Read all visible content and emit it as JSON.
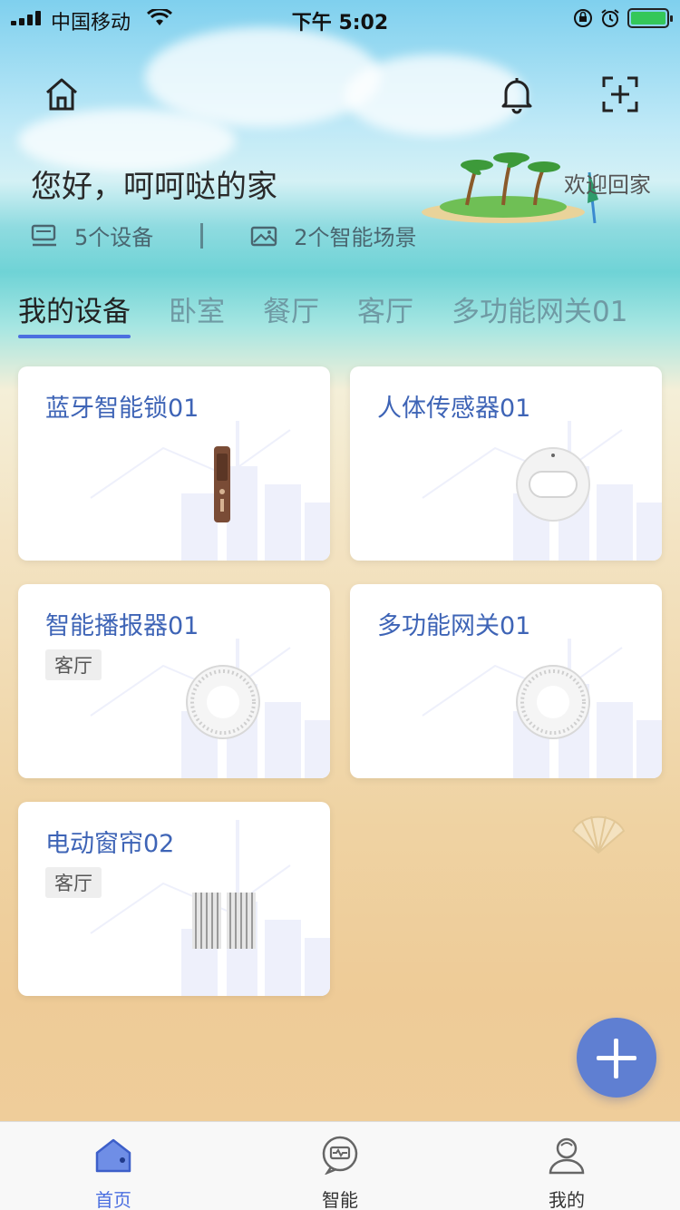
{
  "status_bar": {
    "carrier": "中国移动",
    "time": "下午 5:02"
  },
  "header": {
    "greeting": "您好，呵呵哒的家",
    "welcome": "欢迎回家",
    "device_count": "5个设备",
    "scene_count": "2个智能场景"
  },
  "icons": {
    "home": "home-icon",
    "bell": "bell-icon",
    "scan": "scan-add-icon"
  },
  "tabs": [
    {
      "label": "我的设备",
      "active": true
    },
    {
      "label": "卧室"
    },
    {
      "label": "餐厅"
    },
    {
      "label": "客厅"
    },
    {
      "label": "多功能网关01"
    }
  ],
  "devices": [
    {
      "name": "蓝牙智能锁01",
      "room": "",
      "icon": "smart-lock-icon"
    },
    {
      "name": "人体传感器01",
      "room": "",
      "icon": "motion-sensor-icon"
    },
    {
      "name": "智能播报器01",
      "room": "客厅",
      "icon": "speaker-icon"
    },
    {
      "name": "多功能网关01",
      "room": "",
      "icon": "gateway-icon"
    },
    {
      "name": "电动窗帘02",
      "room": "客厅",
      "icon": "curtain-icon"
    }
  ],
  "bottom_nav": [
    {
      "label": "首页",
      "active": true
    },
    {
      "label": "智能"
    },
    {
      "label": "我的"
    }
  ],
  "colors": {
    "accent": "#4b6fe0",
    "card_title": "#3e64b6",
    "fab": "#5f7fd2"
  }
}
